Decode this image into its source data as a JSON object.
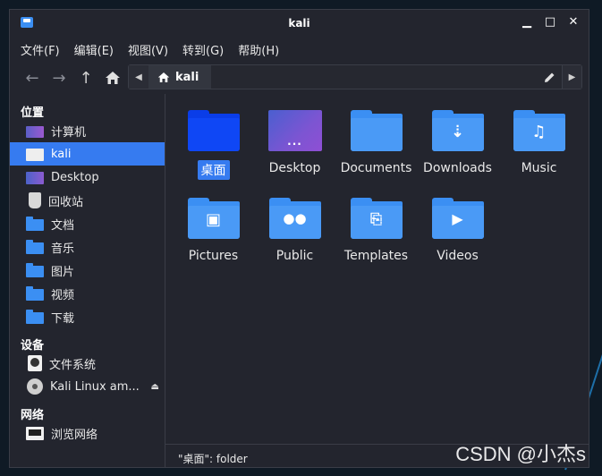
{
  "window": {
    "title": "kali"
  },
  "window_controls": {
    "minimize": "▁",
    "maximize": "□",
    "close": "✕"
  },
  "menu": [
    "文件(F)",
    "编辑(E)",
    "视图(V)",
    "转到(G)",
    "帮助(H)"
  ],
  "toolbar": {
    "back": "←",
    "forward": "→",
    "up": "↑"
  },
  "location": {
    "crumb": "kali"
  },
  "sidebar": {
    "places_heading": "位置",
    "places": [
      "计算机",
      "kali",
      "Desktop",
      "回收站",
      "文档",
      "音乐",
      "图片",
      "视频",
      "下载"
    ],
    "devices_heading": "设备",
    "devices": [
      "文件系统",
      "Kali Linux am..."
    ],
    "network_heading": "网络",
    "network": [
      "浏览网络"
    ]
  },
  "files": [
    {
      "name": "桌面",
      "icon": "desktop-folder-icon",
      "selected": true
    },
    {
      "name": "Desktop",
      "icon": "desktop-tile-icon",
      "selected": false
    },
    {
      "name": "Documents",
      "icon": "folder-icon",
      "selected": false
    },
    {
      "name": "Downloads",
      "icon": "downloads-folder-icon",
      "selected": false
    },
    {
      "name": "Music",
      "icon": "music-folder-icon",
      "selected": false
    },
    {
      "name": "Pictures",
      "icon": "pictures-folder-icon",
      "selected": false
    },
    {
      "name": "Public",
      "icon": "public-folder-icon",
      "selected": false
    },
    {
      "name": "Templates",
      "icon": "templates-folder-icon",
      "selected": false
    },
    {
      "name": "Videos",
      "icon": "videos-folder-icon",
      "selected": false
    }
  ],
  "status": {
    "text": "\"桌面\": folder"
  },
  "watermark": "CSDN @小杰s",
  "colors": {
    "accent": "#367bf0",
    "folder": "#3b8ff3",
    "background": "#23252e"
  }
}
